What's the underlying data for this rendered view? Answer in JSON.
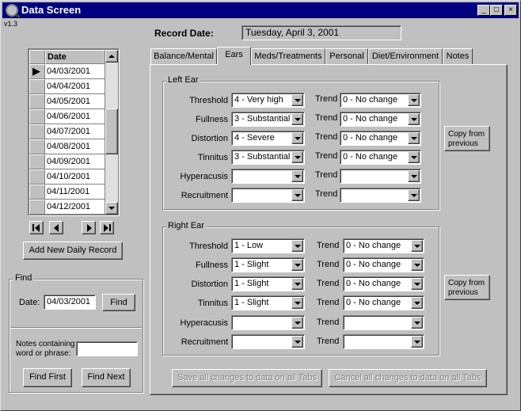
{
  "window": {
    "title": "Data Screen",
    "version": "v1.3",
    "minimize_label": "_",
    "maximize_label": "□",
    "close_label": "×"
  },
  "record_date": {
    "label": "Record Date:",
    "value": "Tuesday, April 3, 2001"
  },
  "tabs": [
    {
      "label": "Balance/Mental"
    },
    {
      "label": "Ears"
    },
    {
      "label": "Meds/Treatments"
    },
    {
      "label": "Personal"
    },
    {
      "label": "Diet/Environment"
    },
    {
      "label": "Notes"
    }
  ],
  "active_tab": "Ears",
  "date_grid": {
    "header": "Date",
    "rows": [
      "04/03/2001",
      "04/04/2001",
      "04/05/2001",
      "04/06/2001",
      "04/07/2001",
      "04/08/2001",
      "04/09/2001",
      "04/10/2001",
      "04/11/2001",
      "04/12/2001"
    ],
    "current_row_marker": "▶"
  },
  "add_record_button": "Add New Daily Record",
  "find": {
    "group_label": "Find",
    "date_label": "Date:",
    "date_value": "04/03/2001",
    "find_button": "Find",
    "notes_label_1": "Notes containing",
    "notes_label_2": "word or phrase:",
    "notes_value": "",
    "find_first_button": "Find First",
    "find_next_button": "Find Next"
  },
  "left_ear": {
    "group_label": "Left Ear",
    "rows": [
      {
        "label": "Threshold",
        "value": "4 - Very high",
        "trend_label": "Trend",
        "trend": "0 - No change"
      },
      {
        "label": "Fullness",
        "value": "3 - Substantial",
        "trend_label": "Trend",
        "trend": "0 - No change"
      },
      {
        "label": "Distortion",
        "value": "4 - Severe",
        "trend_label": "Trend",
        "trend": "0 - No change"
      },
      {
        "label": "Tinnitus",
        "value": "3 - Substantial",
        "trend_label": "Trend",
        "trend": "0 - No change"
      },
      {
        "label": "Hyperacusis",
        "value": "",
        "trend_label": "Trend",
        "trend": ""
      },
      {
        "label": "Recruitment",
        "value": "",
        "trend_label": "Trend",
        "trend": ""
      }
    ],
    "copy_button_1": "Copy from",
    "copy_button_2": "previous"
  },
  "right_ear": {
    "group_label": "Right Ear",
    "rows": [
      {
        "label": "Threshold",
        "value": "1 - Low",
        "trend_label": "Trend",
        "trend": "0 - No change"
      },
      {
        "label": "Fullness",
        "value": "1 - Slight",
        "trend_label": "Trend",
        "trend": "0 - No change"
      },
      {
        "label": "Distortion",
        "value": "1 - Slight",
        "trend_label": "Trend",
        "trend": "0 - No change"
      },
      {
        "label": "Tinnitus",
        "value": "1 - Slight",
        "trend_label": "Trend",
        "trend": "0 - No change"
      },
      {
        "label": "Hyperacusis",
        "value": "",
        "trend_label": "Trend",
        "trend": ""
      },
      {
        "label": "Recruitment",
        "value": "",
        "trend_label": "Trend",
        "trend": ""
      }
    ],
    "copy_button_1": "Copy from",
    "copy_button_2": "previous"
  },
  "save_button": "Save all changes to data on all Tabs",
  "cancel_button": "Cancel all changes to data on all Tabs",
  "colors": {
    "titlebar": "#000080",
    "face": "#c0c0c0",
    "disabled_text": "#808080"
  }
}
